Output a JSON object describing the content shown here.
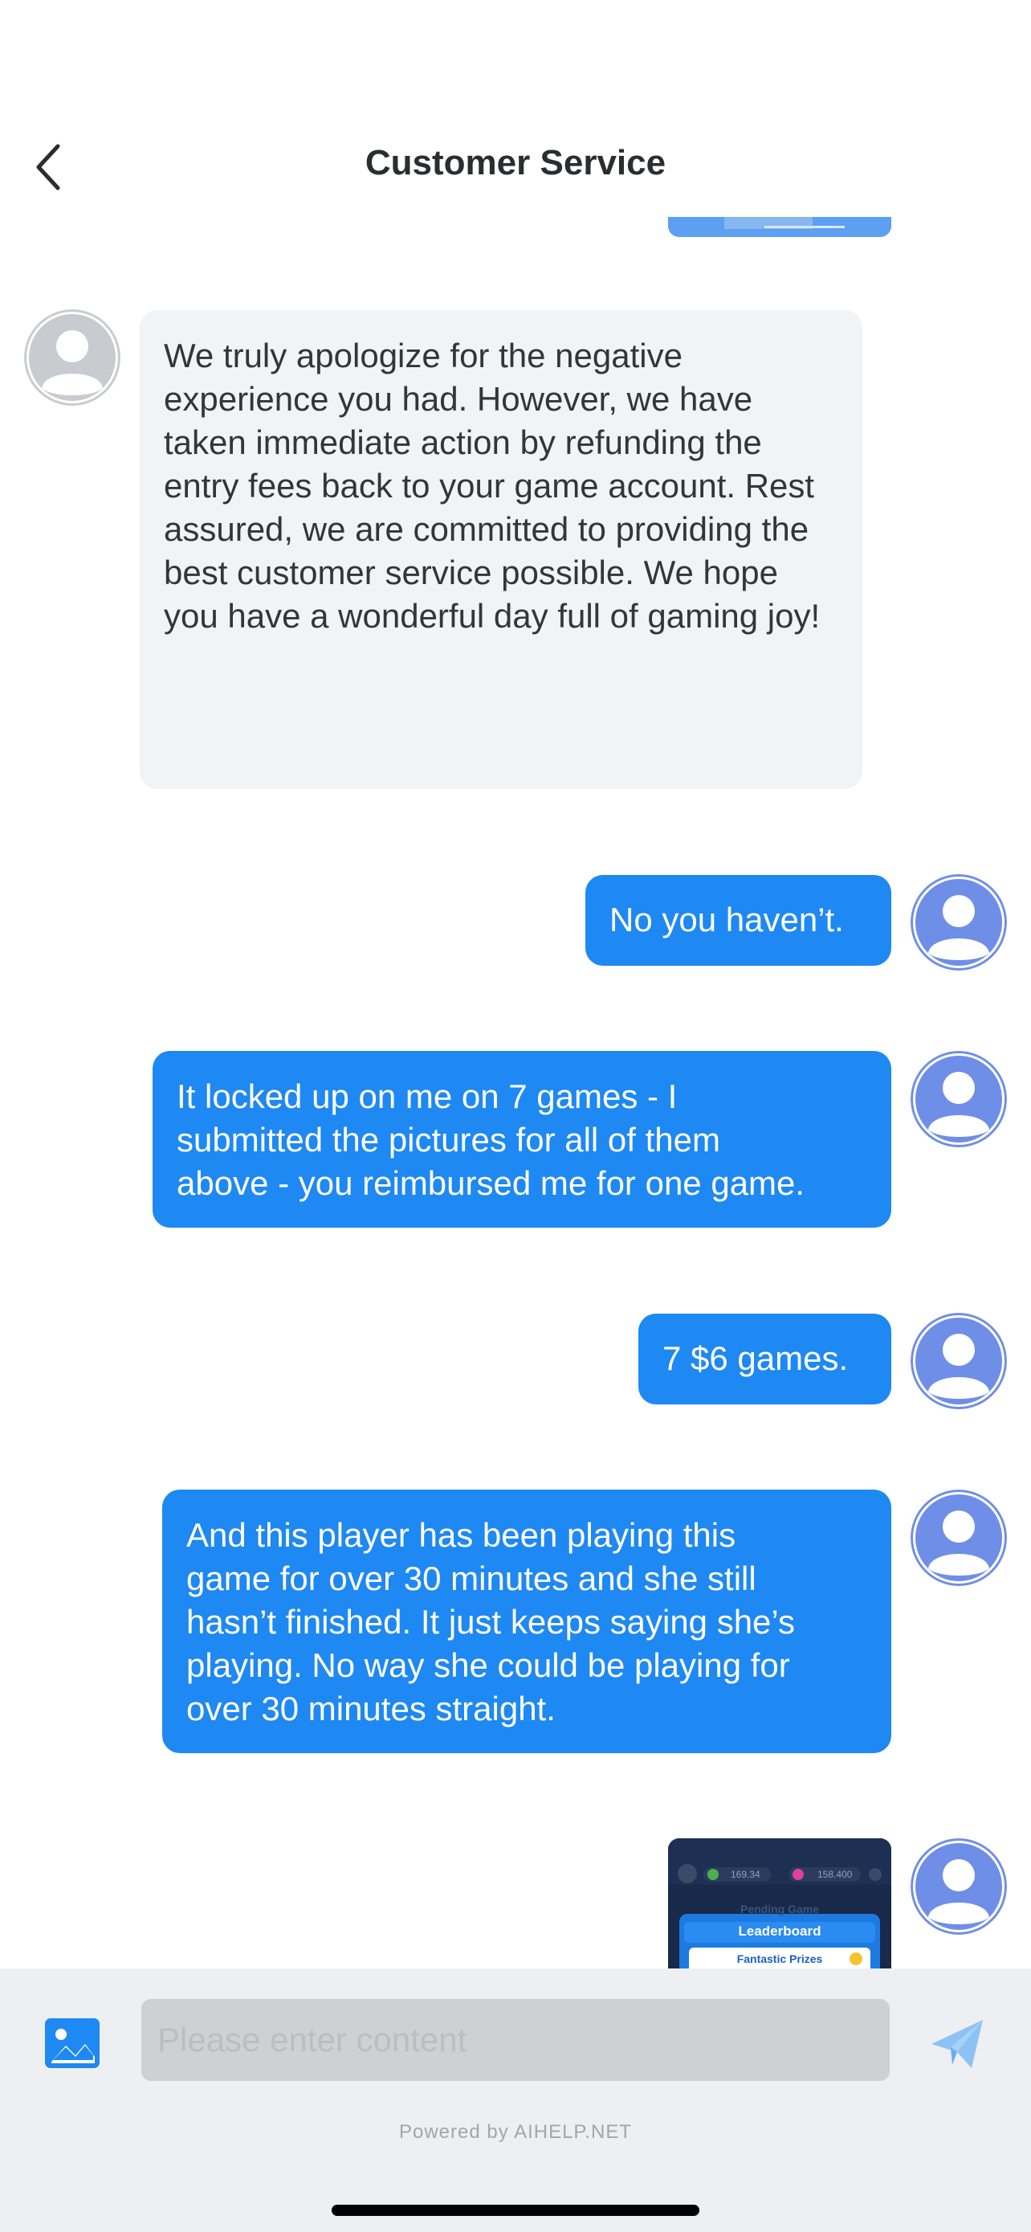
{
  "header": {
    "title": "Customer Service"
  },
  "messages": [
    {
      "sender": "agent",
      "text": "We truly apologize for the negative experience you had. However, we have taken immediate action by refunding the entry fees back to your game account. Rest assured, we are committed to providing the best customer service possible. We hope you have a wonderful day full of gaming joy!"
    },
    {
      "sender": "user",
      "text": "No you haven’t."
    },
    {
      "sender": "user",
      "text": "It locked up on me on 7 games - I\nsubmitted the pictures for all of them\nabove - you reimbursed me for one game."
    },
    {
      "sender": "user",
      "text": "7 $6 games."
    },
    {
      "sender": "user",
      "text": "And this player has been playing this\ngame for over 30 minutes and she still\nhasn’t finished. It just keeps saying she’s\nplaying. No way she could be playing for\nover 30 minutes straight."
    },
    {
      "sender": "user",
      "type": "image",
      "image": {
        "banner_text": "Leaderboard",
        "subtitle_text": "Fantastic Prizes",
        "stat_1": "169.34",
        "stat_2": "158.400",
        "faded_text": "Pending Game"
      }
    }
  ],
  "input": {
    "placeholder": "Please enter content",
    "value": ""
  },
  "footer": {
    "powered_by": "Powered by AIHELP.NET"
  },
  "colors": {
    "user_bubble": "#1e88f3",
    "agent_bubble": "#f2f3f5",
    "user_avatar": "#6f8ee8",
    "agent_avatar": "#c9cbd0",
    "send_icon": "#8cc3f4",
    "image_icon": "#1e88f3"
  },
  "icons": {
    "back": "chevron-left-icon",
    "image": "image-icon",
    "send": "paper-plane-icon",
    "avatar": "user-silhouette-icon"
  }
}
